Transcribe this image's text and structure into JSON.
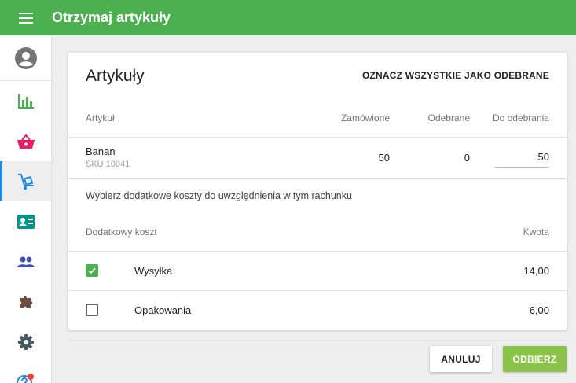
{
  "app": {
    "title": "Otrzymaj artykuły",
    "accent_color": "#4caf50"
  },
  "sidebar": {
    "items": [
      {
        "icon": "account-circle-icon",
        "color": "#757575",
        "active": false
      },
      {
        "icon": "bar-chart-icon",
        "color": "#4caf50",
        "active": false
      },
      {
        "icon": "shopping-basket-icon",
        "color": "#e91e63",
        "active": false
      },
      {
        "icon": "hand-truck-icon",
        "color": "#1e88e5",
        "active": true
      },
      {
        "icon": "contact-card-icon",
        "color": "#009688",
        "active": false
      },
      {
        "icon": "people-icon",
        "color": "#3f51b5",
        "active": false
      },
      {
        "icon": "puzzle-icon",
        "color": "#6d4c41",
        "active": false
      },
      {
        "icon": "gear-icon",
        "color": "#455a64",
        "active": false
      },
      {
        "icon": "help-icon",
        "color": "#1e88e5",
        "active": false,
        "badge_color": "#f44336"
      }
    ]
  },
  "card": {
    "title": "Artykuły",
    "mark_all_label": "OZNACZ WSZYSTKIE JAKO ODEBRANE",
    "columns": {
      "item": "Artykuł",
      "ordered": "Zamówione",
      "received": "Odebrane",
      "to_receive": "Do odebrania"
    },
    "items": [
      {
        "name": "Banan",
        "sku": "SKU 10041",
        "ordered": "50",
        "received": "0",
        "to_receive": "50"
      }
    ],
    "costs_intro": "Wybierz dodatkowe koszty do uwzględnienia w tym rachunku",
    "cost_columns": {
      "name": "Dodatkowy koszt",
      "amount": "Kwota"
    },
    "costs": [
      {
        "name": "Wysyłka",
        "amount": "14,00",
        "checked": true
      },
      {
        "name": "Opakowania",
        "amount": "6,00",
        "checked": false
      }
    ]
  },
  "actions": {
    "cancel_label": "ANULUJ",
    "receive_label": "ODBIERZ"
  }
}
